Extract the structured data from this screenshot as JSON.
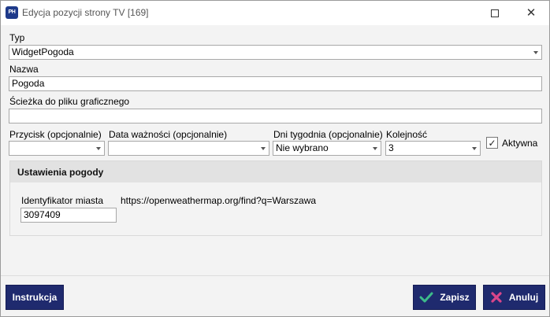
{
  "window": {
    "app_icon_text": "PH",
    "title": "Edycja pozycji strony TV [169]",
    "maximize_icon": "maximize-icon",
    "close_icon": "close-icon"
  },
  "form": {
    "typ": {
      "label": "Typ",
      "value": "WidgetPogoda"
    },
    "nazwa": {
      "label": "Nazwa",
      "value": "Pogoda"
    },
    "sciezka": {
      "label": "Ścieżka do pliku graficznego",
      "value": ""
    },
    "przycisk": {
      "label": "Przycisk (opcjonalnie)",
      "value": ""
    },
    "data_waznosci": {
      "label": "Data ważności (opcjonalnie)",
      "value": ""
    },
    "dni_tygodnia": {
      "label": "Dni tygodnia (opcjonalnie)",
      "value": "Nie wybrano"
    },
    "kolejnosc": {
      "label": "Kolejność",
      "value": "3"
    },
    "aktywna": {
      "label": "Aktywna",
      "checked": true,
      "check_glyph": "✓"
    }
  },
  "weather": {
    "title": "Ustawienia pogody",
    "city_id": {
      "label": "Identyfikator miasta",
      "value": "3097409"
    },
    "link": "https://openweathermap.org/find?q=Warszawa"
  },
  "footer": {
    "instrukcja_label": "Instrukcja",
    "zapisz_label": "Zapisz",
    "anuluj_label": "Anuluj"
  },
  "colors": {
    "button_bg": "#1f2a6e",
    "check_icon": "#3dbb8a",
    "cancel_icon": "#d9468a"
  }
}
